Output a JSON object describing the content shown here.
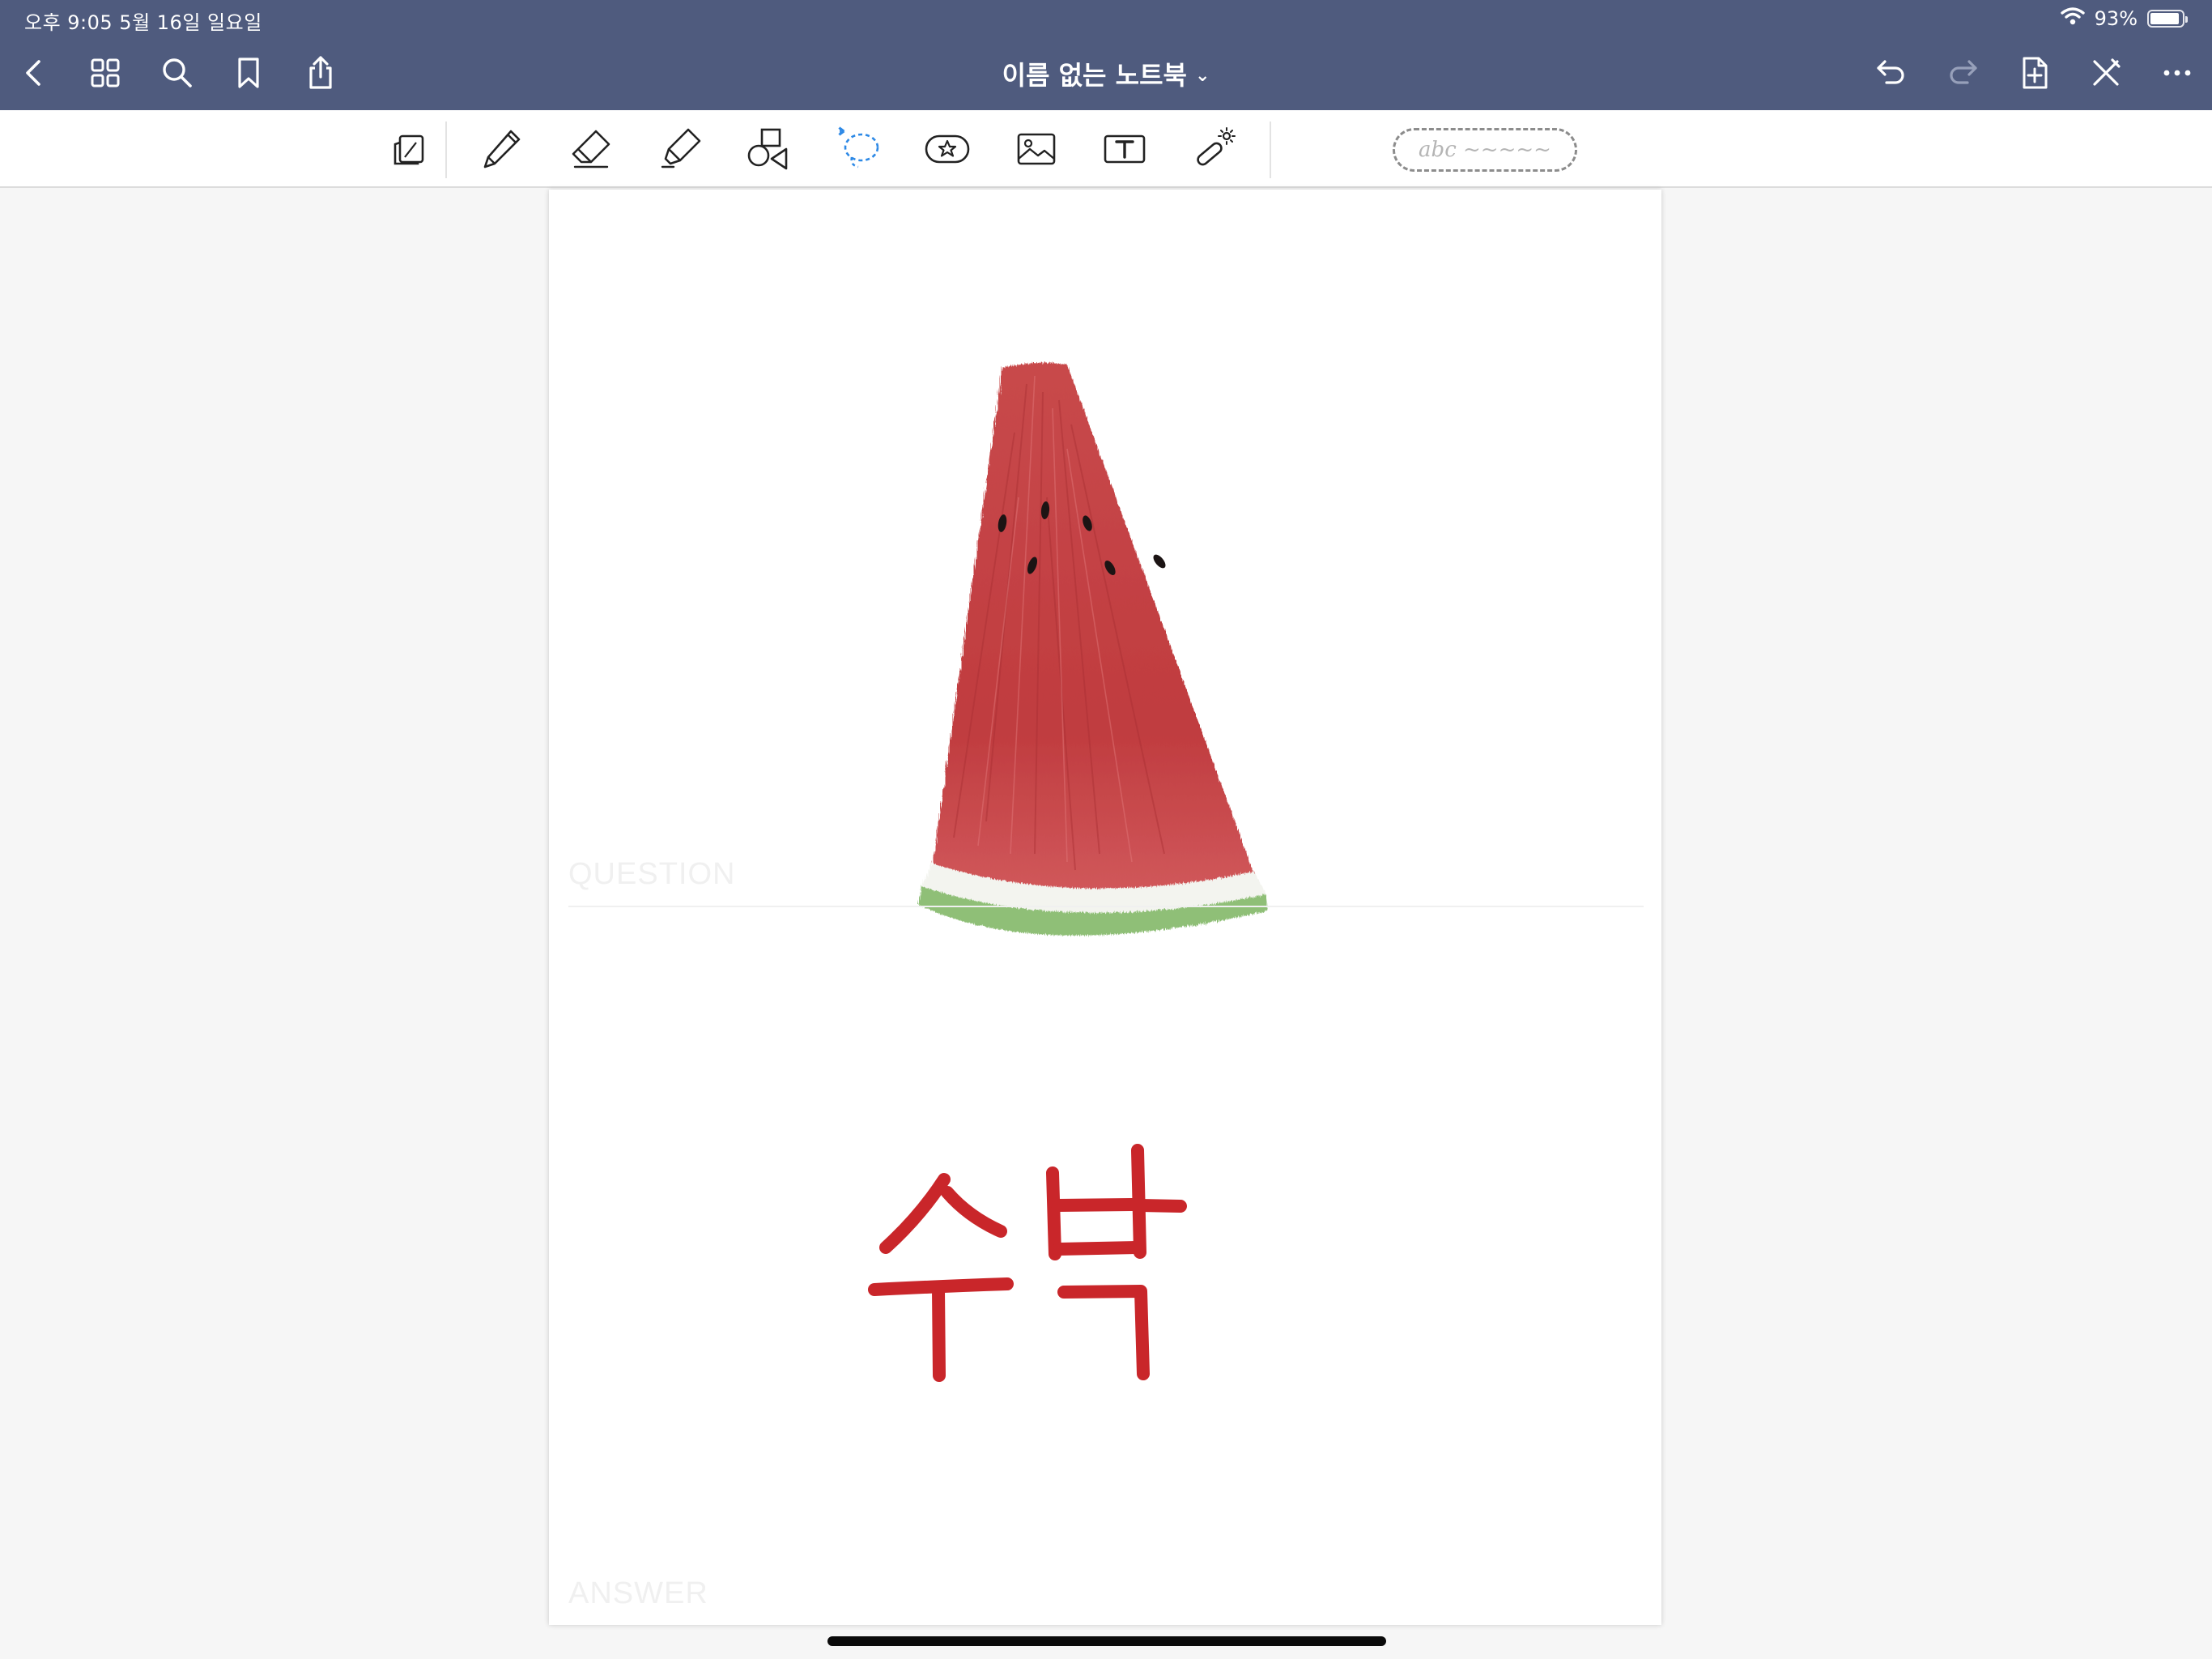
{
  "status_bar": {
    "time_date": "오후 9:05   5월 16일 일요일",
    "battery_label": "93%",
    "battery_level": 0.93
  },
  "nav": {
    "title": "이름 없는 노트북",
    "title_chevron": "⌄"
  },
  "toolbar": {
    "handwriting_placeholder": "abc ~~~~~",
    "active_tool": "lasso",
    "active_color": "#2d89e6"
  },
  "page": {
    "question_label": "QUESTION",
    "answer_label": "ANSWER",
    "answer_handwriting": "수박",
    "ink_color": "#c9262a"
  }
}
